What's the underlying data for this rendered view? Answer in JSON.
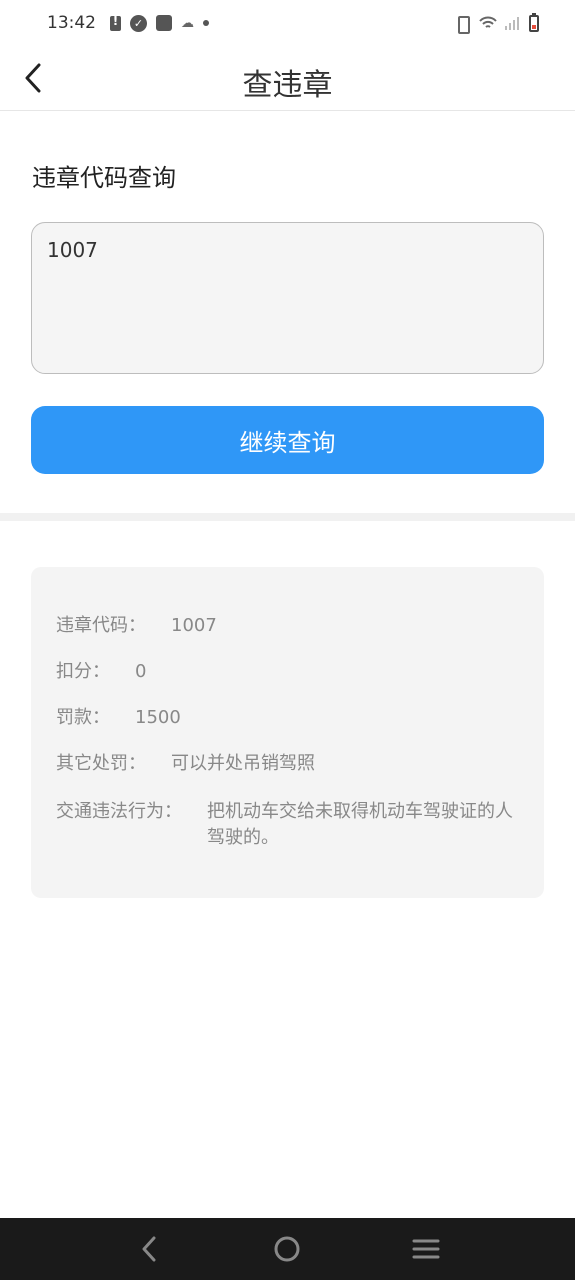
{
  "status_bar": {
    "time": "13:42"
  },
  "header": {
    "title": "查违章"
  },
  "query": {
    "section_title": "违章代码查询",
    "input_value": "1007",
    "button_label": "继续查询"
  },
  "result": {
    "code_label": "违章代码：",
    "code_value": "1007",
    "points_label": "扣分：",
    "points_value": "0",
    "fine_label": "罚款：",
    "fine_value": "1500",
    "other_label": "其它处罚：",
    "other_value": "可以并处吊销驾照",
    "behavior_label": "交通违法行为：",
    "behavior_value": "把机动车交给未取得机动车驾驶证的人驾驶的。"
  },
  "colors": {
    "accent": "#2f97f7",
    "card_bg": "#f4f4f4",
    "nav_bar_bg": "#1a1a1a"
  }
}
